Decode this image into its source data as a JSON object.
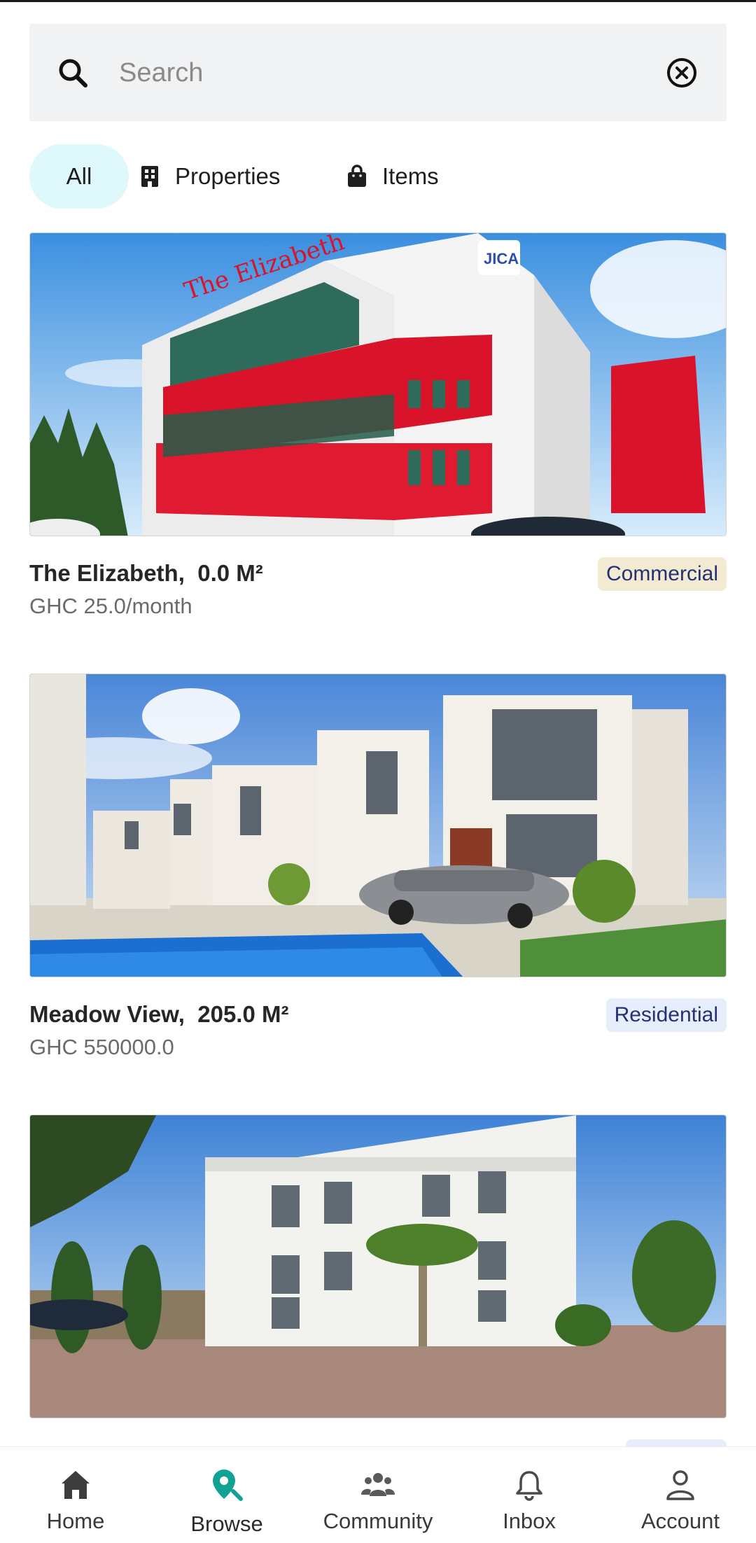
{
  "search": {
    "placeholder": "Search",
    "value": ""
  },
  "filters": [
    {
      "label": "All",
      "icon": "grid-icon",
      "active": true
    },
    {
      "label": "Properties",
      "icon": "building-icon",
      "active": false
    },
    {
      "label": "Items",
      "icon": "shopping-bag-icon",
      "active": false
    }
  ],
  "listings": [
    {
      "name": "The Elizabeth,",
      "size": "0.0 M²",
      "price": "GHC 25.0/month",
      "category": "Commercial",
      "category_color": "#f3ead3"
    },
    {
      "name": "Meadow View,",
      "size": "205.0 M²",
      "price": "GHC 550000.0",
      "category": "Residential",
      "category_color": "#e6edfb"
    },
    {
      "name": "",
      "size": "",
      "price": "",
      "category": "",
      "category_color": "#e6edfb"
    }
  ],
  "nav": [
    {
      "label": "Home",
      "icon": "home-icon",
      "active": false
    },
    {
      "label": "Browse",
      "icon": "map-search-icon",
      "active": true
    },
    {
      "label": "Community",
      "icon": "people-icon",
      "active": false
    },
    {
      "label": "Inbox",
      "icon": "bell-icon",
      "active": false
    },
    {
      "label": "Account",
      "icon": "person-icon",
      "active": false
    }
  ],
  "colors": {
    "accent": "#12a294",
    "chip_active_bg": "#dff8fb",
    "badge_text": "#253170"
  }
}
